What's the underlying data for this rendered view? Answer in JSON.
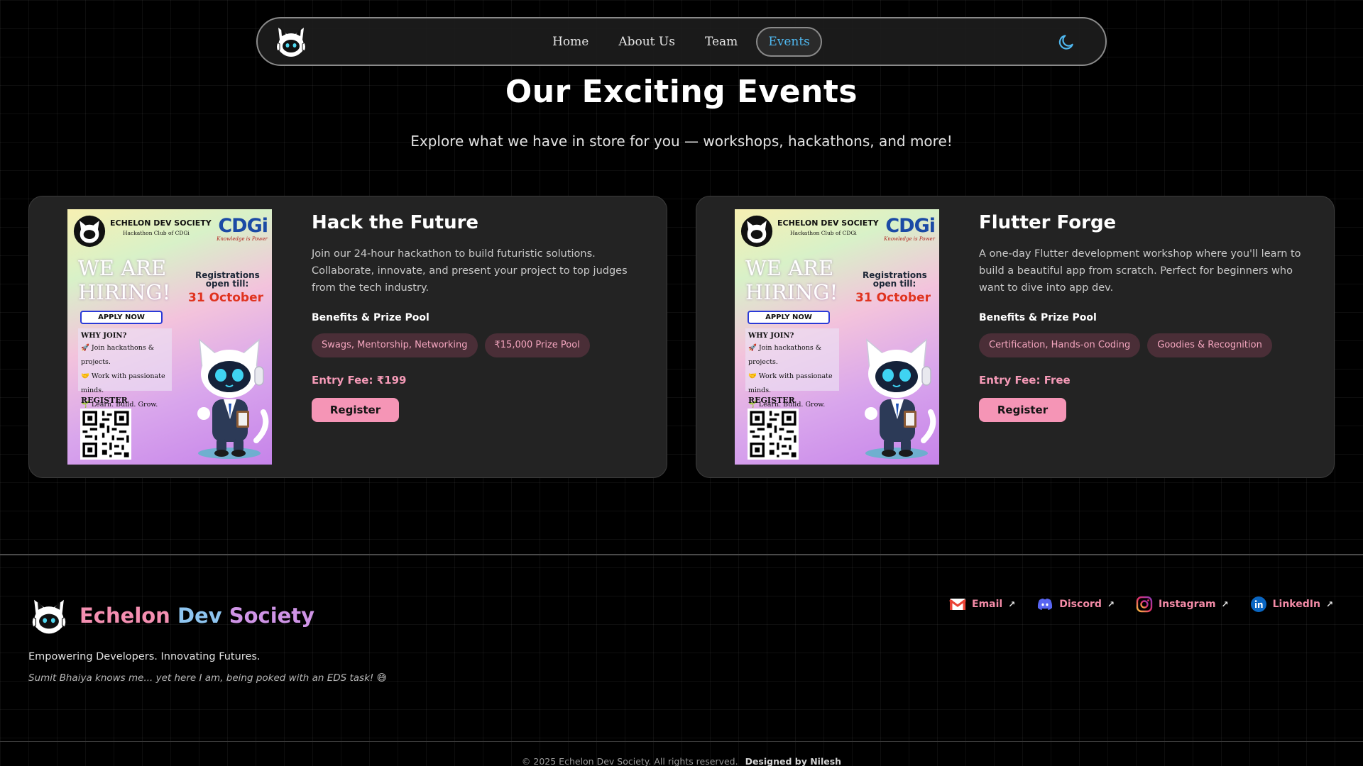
{
  "nav": {
    "links": [
      {
        "label": "Home"
      },
      {
        "label": "About Us"
      },
      {
        "label": "Team"
      },
      {
        "label": "Events",
        "active": true
      }
    ],
    "logo_icon": "cat-logo-icon",
    "theme_icon": "moon-icon"
  },
  "hero": {
    "title": "Our Exciting Events",
    "subtitle": "Explore what we have in store for you — workshops, hackathons, and more!"
  },
  "poster": {
    "brand": "ECHELON DEV SOCIETY",
    "brand_sub": "Hackathon Club of CDGi",
    "cdgi": "CDGi",
    "cdgi_tag": "Knowledge is Power",
    "headline_1": "WE ARE",
    "headline_2": "HIRING!",
    "registrations": "Registrations open till:",
    "date": "31 October",
    "apply": "APPLY NOW",
    "why_title": "WHY JOIN?",
    "why_1": "🚀 Join hackathons & projects.",
    "why_2": "🤝 Work with passionate minds.",
    "why_3": "🌱 Learn. Build. Grow.",
    "register": "REGISTER"
  },
  "events": [
    {
      "title": "Hack the Future",
      "description": "Join our 24-hour hackathon to build futuristic solutions. Collaborate, innovate, and present your project to top judges from the tech industry.",
      "benefits_heading": "Benefits & Prize Pool",
      "tags": [
        "Swags, Mentorship, Networking",
        "₹15,000 Prize Pool"
      ],
      "entry_fee": "Entry Fee: ₹199",
      "register_label": "Register"
    },
    {
      "title": "Flutter Forge",
      "description": "A one-day Flutter development workshop where you'll learn to build a beautiful app from scratch. Perfect for beginners who want to dive into app dev.",
      "benefits_heading": "Benefits & Prize Pool",
      "tags": [
        "Certification, Hands-on Coding",
        "Goodies & Recognition"
      ],
      "entry_fee": "Entry Fee: Free",
      "register_label": "Register"
    }
  ],
  "footer": {
    "brand_words": [
      "Echelon",
      "Dev",
      "Society"
    ],
    "tagline": "Empowering Developers. Innovating Futures.",
    "quote": "Sumit Bhaiya knows me... yet here I am, being poked with an EDS task! 😅",
    "social": [
      {
        "label": "Email",
        "icon": "gmail-icon"
      },
      {
        "label": "Discord",
        "icon": "discord-icon"
      },
      {
        "label": "Instagram",
        "icon": "instagram-icon"
      },
      {
        "label": "LinkedIn",
        "icon": "linkedin-icon"
      }
    ],
    "copyright": "© 2025 Echelon Dev Society. All rights reserved.",
    "designer": "Designed by Nilesh"
  },
  "colors": {
    "accent_pink": "#f595b6",
    "accent_blue": "#4fb8f0",
    "tag_bg": "#4a2e37",
    "card_bg": "#232323"
  }
}
